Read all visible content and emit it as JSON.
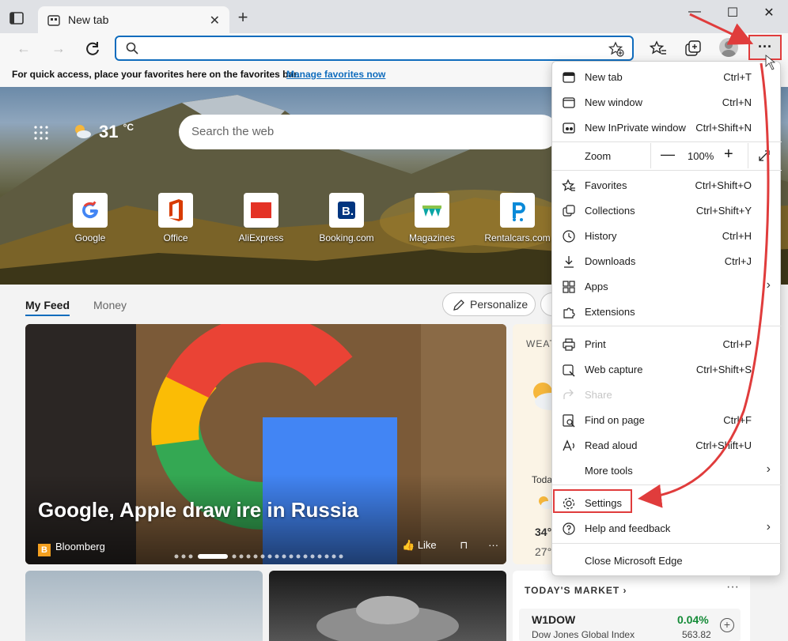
{
  "tab": {
    "title": "New tab"
  },
  "favbar": {
    "message": "For quick access, place your favorites here on the favorites bar.",
    "link": "Manage favorites now"
  },
  "weather": {
    "temp": "31",
    "unit": "°C"
  },
  "search": {
    "placeholder": "Search the web"
  },
  "tiles": [
    {
      "label": "Google"
    },
    {
      "label": "Office"
    },
    {
      "label": "AliExpress"
    },
    {
      "label": "Booking.com"
    },
    {
      "label": "Magazines"
    },
    {
      "label": "Rentalcars.com"
    }
  ],
  "feed": {
    "tabs": [
      "My Feed",
      "Money"
    ],
    "personalize": "Personalize",
    "headline": "Google, Apple draw ire in Russia",
    "source": "Bloomberg",
    "like": "Like",
    "weather_card": {
      "header": "WEAT",
      "today": "Toda",
      "hi": "34°",
      "lo": "27°"
    },
    "market": {
      "header": "TODAY'S MARKET",
      "symbol": "W1DOW",
      "name": "Dow Jones Global Index",
      "change": "0.04%",
      "value": "563.82"
    }
  },
  "menu": {
    "items_top": [
      {
        "label": "New tab",
        "shortcut": "Ctrl+T",
        "icon": "new-tab-icon"
      },
      {
        "label": "New window",
        "shortcut": "Ctrl+N",
        "icon": "new-window-icon"
      },
      {
        "label": "New InPrivate window",
        "shortcut": "Ctrl+Shift+N",
        "icon": "inprivate-icon"
      }
    ],
    "zoom": {
      "label": "Zoom",
      "value": "100%"
    },
    "items_mid": [
      {
        "label": "Favorites",
        "shortcut": "Ctrl+Shift+O",
        "icon": "favorites-icon"
      },
      {
        "label": "Collections",
        "shortcut": "Ctrl+Shift+Y",
        "icon": "collections-icon"
      },
      {
        "label": "History",
        "shortcut": "Ctrl+H",
        "icon": "history-icon"
      },
      {
        "label": "Downloads",
        "shortcut": "Ctrl+J",
        "icon": "downloads-icon"
      },
      {
        "label": "Apps",
        "shortcut": "",
        "icon": "apps-icon"
      },
      {
        "label": "Extensions",
        "shortcut": "",
        "icon": "extensions-icon"
      }
    ],
    "items_tools": [
      {
        "label": "Print",
        "shortcut": "Ctrl+P",
        "icon": "print-icon"
      },
      {
        "label": "Web capture",
        "shortcut": "Ctrl+Shift+S",
        "icon": "web-capture-icon"
      },
      {
        "label": "Share",
        "shortcut": "",
        "icon": "share-icon"
      },
      {
        "label": "Find on page",
        "shortcut": "Ctrl+F",
        "icon": "find-icon"
      },
      {
        "label": "Read aloud",
        "shortcut": "Ctrl+Shift+U",
        "icon": "read-aloud-icon"
      },
      {
        "label": "More tools",
        "shortcut": "",
        "icon": "more-tools-icon"
      }
    ],
    "items_bottom": [
      {
        "label": "Settings",
        "icon": "settings-icon"
      },
      {
        "label": "Help and feedback",
        "icon": "help-icon"
      }
    ],
    "close": "Close Microsoft Edge"
  },
  "colors": {
    "accent": "#0f6cbd",
    "annotation": "#e03c3c",
    "market_up": "#138a36"
  }
}
